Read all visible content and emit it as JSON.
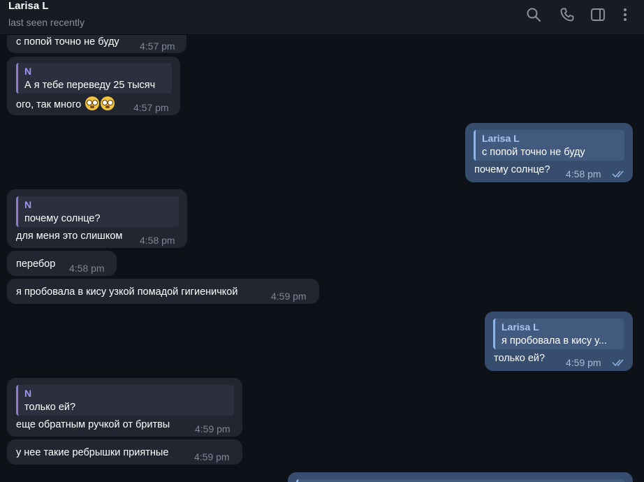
{
  "header": {
    "contact_name": "Larisa L",
    "status": "last seen recently",
    "icons": [
      "search-icon",
      "phone-icon",
      "sidebar-toggle-icon",
      "more-icon"
    ]
  },
  "messages": [
    {
      "direction": "in",
      "text": "с попой точно не буду",
      "time": "4:57 pm"
    },
    {
      "direction": "in",
      "reply_name": "N",
      "reply_text": "А я тебе переведу 25 тысяч",
      "text": "ого, так много",
      "emoji": "flushed-face-emoji x2",
      "time": "4:57 pm"
    },
    {
      "direction": "out",
      "reply_name": "Larisa L",
      "reply_text": "с попой точно не буду",
      "text": "почему солнце?",
      "time": "4:58 pm",
      "read": true
    },
    {
      "direction": "in",
      "reply_name": "N",
      "reply_text": "почему солнце?",
      "text": "для меня это слишком",
      "time": "4:58 pm"
    },
    {
      "direction": "in",
      "text": "перебор",
      "time": "4:58 pm"
    },
    {
      "direction": "in",
      "text": "я пробовала в кису узкой помадой гигиеничкой",
      "time": "4:59 pm"
    },
    {
      "direction": "out",
      "reply_name": "Larisa L",
      "reply_text": "я пробовала в кису у...",
      "text": "только ей?",
      "time": "4:59 pm",
      "read": true
    },
    {
      "direction": "in",
      "reply_name": "N",
      "reply_text": "только ей?",
      "text": "еще обратным ручкой от бритвы",
      "time": "4:59 pm"
    },
    {
      "direction": "in",
      "text": "у нее такие ребрышки приятные",
      "time": "4:59 pm"
    }
  ],
  "colors": {
    "background": "#0e1117",
    "incoming_bubble": "#212630",
    "outgoing_bubble": "#374d6e",
    "reply_accent": "#8d78d4",
    "read_check": "#6f9bd6"
  }
}
